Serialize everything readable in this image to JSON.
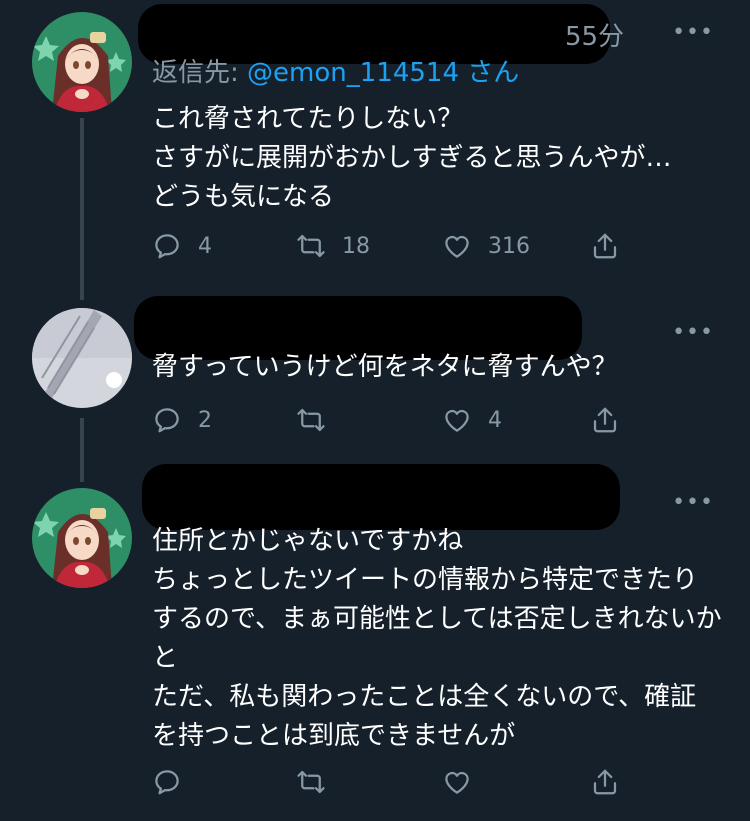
{
  "tweets": [
    {
      "time": "55分",
      "reply_prefix": "返信先: ",
      "reply_handle": "@emon_114514",
      "reply_suffix": " さん",
      "text": "これ脅されてたりしない？\nさすがに展開がおかしすぎると思うんやが…\nどうも気になる",
      "replies": "4",
      "retweets": "18",
      "likes": "316"
    },
    {
      "text": "脅すっていうけど何をネタに脅すんや？",
      "replies": "2",
      "retweets": "",
      "likes": "4"
    },
    {
      "text": "住所とかじゃないですかね\nちょっとしたツイートの情報から特定できたりするので、まぁ可能性としては否定しきれないかと\nただ、私も関わったことは全くないので、確証を持つことは到底できませんが",
      "replies": "",
      "retweets": "",
      "likes": ""
    }
  ],
  "more_label": "•••",
  "icons": [
    "reply-icon",
    "retweet-icon",
    "like-icon",
    "share-icon"
  ],
  "colors": {
    "background": "#15202b",
    "text": "#ffffff",
    "muted": "#8899a6",
    "link": "#1da1f2",
    "thread_line": "#38444d"
  }
}
